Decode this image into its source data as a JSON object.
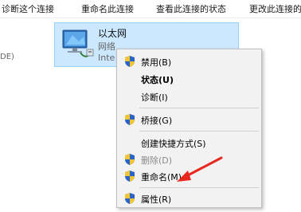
{
  "commandbar": {
    "items": [
      {
        "label": "诊断这个连接"
      },
      {
        "label": "重命名此连接"
      },
      {
        "label": "查看此连接的状态"
      },
      {
        "label": "更改此连接的设"
      }
    ]
  },
  "left_fragment": {
    "text": "DE)"
  },
  "adapter": {
    "name": "以太网",
    "status": "网络",
    "device": "Inte",
    "icon": "network-adapter-icon"
  },
  "context_menu": {
    "items": [
      {
        "label": "禁用(B)",
        "shield": true,
        "bold": false,
        "disabled": false
      },
      {
        "label": "状态(U)",
        "shield": false,
        "bold": true,
        "disabled": false
      },
      {
        "label": "诊断(I)",
        "shield": false,
        "bold": false,
        "disabled": false
      },
      {
        "label": "桥接(G)",
        "shield": true,
        "bold": false,
        "disabled": false
      },
      {
        "label": "创建快捷方式(S)",
        "shield": false,
        "bold": false,
        "disabled": false
      },
      {
        "label": "删除(D)",
        "shield": true,
        "bold": false,
        "disabled": true
      },
      {
        "label": "重命名(M)",
        "shield": true,
        "bold": false,
        "disabled": false
      },
      {
        "label": "属性(R)",
        "shield": true,
        "bold": false,
        "disabled": false
      }
    ]
  },
  "colors": {
    "selection_bg": "#cce8ff",
    "menu_bg": "#f2f2f2",
    "arrow": "#e8281e"
  }
}
